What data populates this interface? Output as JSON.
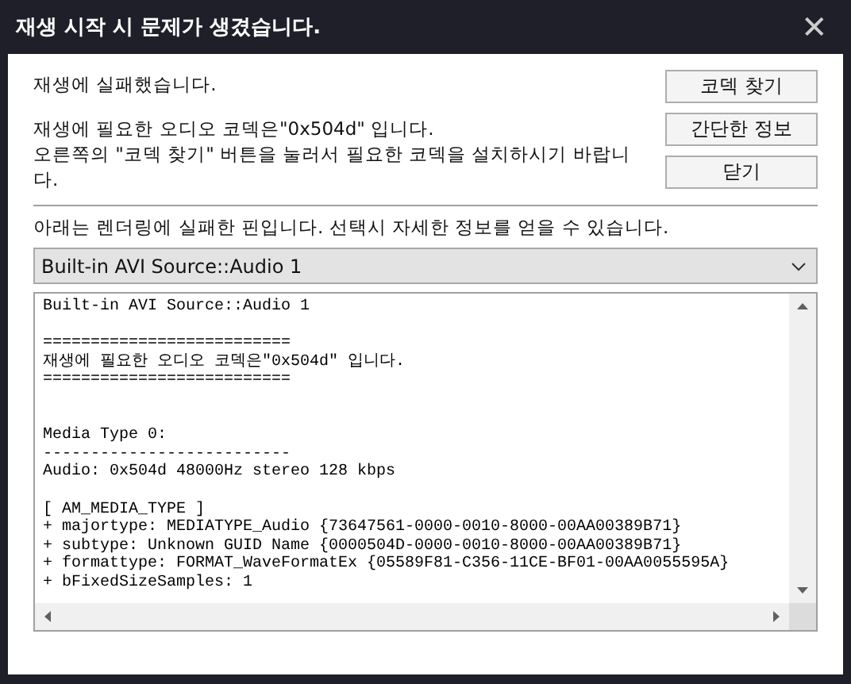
{
  "window": {
    "title": "재생 시작 시 문제가 생겼습니다.",
    "close": "✕"
  },
  "message": {
    "headline": "재생에 실패했습니다.",
    "body": "재생에 필요한 오디오 코덱은\"0x504d\" 입니다.\n오른쪽의 \"코덱 찾기\" 버튼을 눌러서 필요한 코덱을 설치하시기 바랍니다."
  },
  "buttons": [
    "코덱 찾기",
    "간단한 정보",
    "닫기"
  ],
  "pins_label": "아래는 렌더링에 실패한 핀입니다. 선택시 자세한 정보를 얻을 수 있습니다.",
  "pin_select": {
    "value": "Built-in AVI Source::Audio 1"
  },
  "details_text": "Built-in AVI Source::Audio 1\n\n==========================\n재생에 필요한 오디오 코덱은\"0x504d\" 입니다.\n==========================\n\n\nMedia Type 0:\n--------------------------\nAudio: 0x504d 48000Hz stereo 128 kbps\n\n[ AM_MEDIA_TYPE ]\n+ majortype: MEDIATYPE_Audio {73647561-0000-0010-8000-00AA00389B71}\n+ subtype: Unknown GUID Name {0000504D-0000-0010-8000-00AA00389B71}\n+ formattype: FORMAT_WaveFormatEx {05589F81-C356-11CE-BF01-00AA0055595A}\n+ bFixedSizeSamples: 1"
}
